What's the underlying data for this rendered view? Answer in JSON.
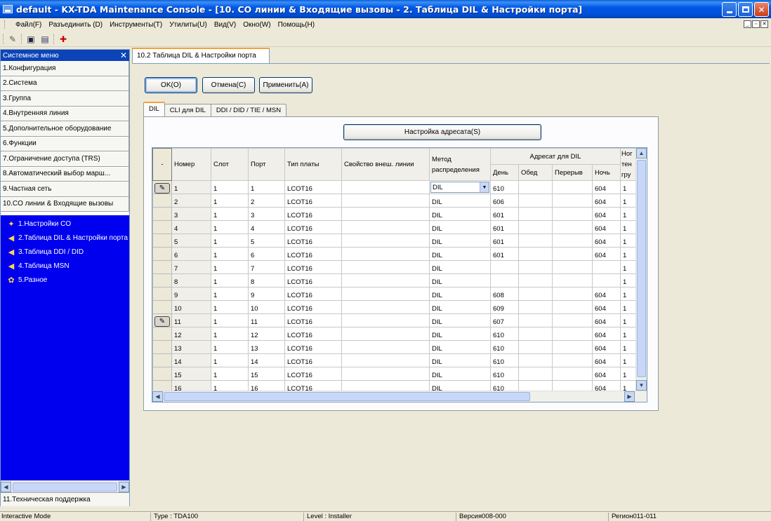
{
  "window": {
    "title": "default - KX-TDA Maintenance Console - [10. CO линии & Входящие вызовы - 2. Таблица DIL & Настройки порта]"
  },
  "menubar": [
    "Файл(F)",
    "Разъединить (D)",
    "Инструменты(T)",
    "Утилиты(U)",
    "Вид(V)",
    "Окно(W)",
    "Помощь(H)"
  ],
  "sidebar": {
    "header": "Системное меню",
    "items": [
      {
        "label": "1.Конфигурация"
      },
      {
        "label": "2.Система"
      },
      {
        "label": "3.Группа"
      },
      {
        "label": "4.Внутренняя линия"
      },
      {
        "label": "5.Дополнительное оборудование"
      },
      {
        "label": "6.Функции"
      },
      {
        "label": "7.Ограничение доступа (TRS)"
      },
      {
        "label": "8.Автоматический выбор марш..."
      },
      {
        "label": "9.Частная сеть"
      },
      {
        "label": "10.CO линии & Входящие вызовы"
      }
    ],
    "subitems": [
      {
        "label": "1.Настройки CO",
        "icon": "co-settings-icon"
      },
      {
        "label": "2.Таблица DIL & Настройки порта",
        "icon": "dil-table-icon"
      },
      {
        "label": "3.Таблица DDI / DID",
        "icon": "ddi-table-icon"
      },
      {
        "label": "4.Таблица MSN",
        "icon": "msn-table-icon"
      },
      {
        "label": "5.Разное",
        "icon": "misc-icon"
      }
    ],
    "bottom": "11.Техническая поддержка"
  },
  "doc_tab": "10.2 Таблица DIL & Настройки порта",
  "buttons": {
    "ok": "OK(O)",
    "cancel": "Отмена(C)",
    "apply": "Применить(A)",
    "destination": "Настройка адресата(S)"
  },
  "subtabs": [
    "DIL",
    "CLI для DIL",
    "DDI / DID / TIE / MSN"
  ],
  "table": {
    "corner": "-",
    "headers": {
      "number": "Номер",
      "slot": "Слот",
      "port": "Порт",
      "card_type": "Тип платы",
      "ext_line_property": "Свойство внеш. линии",
      "method_1": "Метод",
      "method_2": "распределения",
      "dest_group": "Адресат для DIL",
      "day": "День",
      "lunch": "Обед",
      "break": "Перерыв",
      "night": "Ночь",
      "extra_1": "Ног",
      "extra_2": "тен",
      "extra_3": "гру"
    },
    "rows": [
      {
        "num": "1",
        "slot": "1",
        "port": "1",
        "type": "LCOT16",
        "prop": "",
        "method": "DIL",
        "day": "610",
        "lunch": "",
        "brk": "",
        "night": "604",
        "extra": "1"
      },
      {
        "num": "2",
        "slot": "1",
        "port": "2",
        "type": "LCOT16",
        "prop": "",
        "method": "DIL",
        "day": "606",
        "lunch": "",
        "brk": "",
        "night": "604",
        "extra": "1"
      },
      {
        "num": "3",
        "slot": "1",
        "port": "3",
        "type": "LCOT16",
        "prop": "",
        "method": "DIL",
        "day": "601",
        "lunch": "",
        "brk": "",
        "night": "604",
        "extra": "1"
      },
      {
        "num": "4",
        "slot": "1",
        "port": "4",
        "type": "LCOT16",
        "prop": "",
        "method": "DIL",
        "day": "601",
        "lunch": "",
        "brk": "",
        "night": "604",
        "extra": "1"
      },
      {
        "num": "5",
        "slot": "1",
        "port": "5",
        "type": "LCOT16",
        "prop": "",
        "method": "DIL",
        "day": "601",
        "lunch": "",
        "brk": "",
        "night": "604",
        "extra": "1"
      },
      {
        "num": "6",
        "slot": "1",
        "port": "6",
        "type": "LCOT16",
        "prop": "",
        "method": "DIL",
        "day": "601",
        "lunch": "",
        "brk": "",
        "night": "604",
        "extra": "1"
      },
      {
        "num": "7",
        "slot": "1",
        "port": "7",
        "type": "LCOT16",
        "prop": "",
        "method": "DIL",
        "day": "",
        "lunch": "",
        "brk": "",
        "night": "",
        "extra": "1"
      },
      {
        "num": "8",
        "slot": "1",
        "port": "8",
        "type": "LCOT16",
        "prop": "",
        "method": "DIL",
        "day": "",
        "lunch": "",
        "brk": "",
        "night": "",
        "extra": "1"
      },
      {
        "num": "9",
        "slot": "1",
        "port": "9",
        "type": "LCOT16",
        "prop": "",
        "method": "DIL",
        "day": "608",
        "lunch": "",
        "brk": "",
        "night": "604",
        "extra": "1"
      },
      {
        "num": "10",
        "slot": "1",
        "port": "10",
        "type": "LCOT16",
        "prop": "",
        "method": "DIL",
        "day": "609",
        "lunch": "",
        "brk": "",
        "night": "604",
        "extra": "1"
      },
      {
        "num": "11",
        "slot": "1",
        "port": "11",
        "type": "LCOT16",
        "prop": "",
        "method": "DIL",
        "day": "607",
        "lunch": "",
        "brk": "",
        "night": "604",
        "extra": "1"
      },
      {
        "num": "12",
        "slot": "1",
        "port": "12",
        "type": "LCOT16",
        "prop": "",
        "method": "DIL",
        "day": "610",
        "lunch": "",
        "brk": "",
        "night": "604",
        "extra": "1"
      },
      {
        "num": "13",
        "slot": "1",
        "port": "13",
        "type": "LCOT16",
        "prop": "",
        "method": "DIL",
        "day": "610",
        "lunch": "",
        "brk": "",
        "night": "604",
        "extra": "1"
      },
      {
        "num": "14",
        "slot": "1",
        "port": "14",
        "type": "LCOT16",
        "prop": "",
        "method": "DIL",
        "day": "610",
        "lunch": "",
        "brk": "",
        "night": "604",
        "extra": "1"
      },
      {
        "num": "15",
        "slot": "1",
        "port": "15",
        "type": "LCOT16",
        "prop": "",
        "method": "DIL",
        "day": "610",
        "lunch": "",
        "brk": "",
        "night": "604",
        "extra": "1"
      },
      {
        "num": "16",
        "slot": "1",
        "port": "16",
        "type": "LCOT16",
        "prop": "",
        "method": "DIL",
        "day": "610",
        "lunch": "",
        "brk": "",
        "night": "604",
        "extra": "1"
      }
    ]
  },
  "statusbar": {
    "mode": "Interactive Mode",
    "type": "Type : TDA100",
    "level": "Level : Installer",
    "version": "Версия008-000",
    "region": "Регион011-011"
  }
}
